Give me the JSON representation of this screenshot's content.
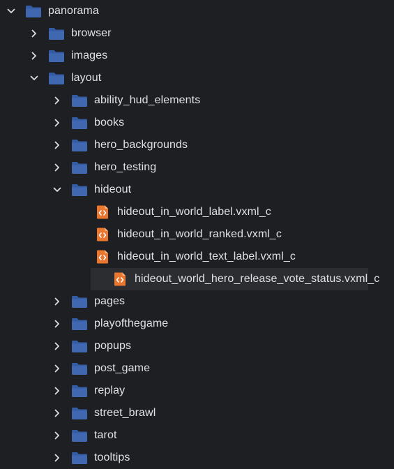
{
  "colors": {
    "background": "#1e1f22",
    "selected_row": "#2b2d30",
    "folder_body": "#3f68b0",
    "folder_tab": "#335ca5",
    "file_icon": "#e9772f",
    "text": "#dfe1e5"
  },
  "tree": [
    {
      "label": "panorama",
      "depth": 0,
      "type": "folder",
      "state": "expanded",
      "icon": "folder-icon"
    },
    {
      "label": "browser",
      "depth": 1,
      "type": "folder",
      "state": "collapsed",
      "icon": "folder-icon"
    },
    {
      "label": "images",
      "depth": 1,
      "type": "folder",
      "state": "collapsed",
      "icon": "folder-icon"
    },
    {
      "label": "layout",
      "depth": 1,
      "type": "folder",
      "state": "expanded",
      "icon": "folder-icon"
    },
    {
      "label": "ability_hud_elements",
      "depth": 2,
      "type": "folder",
      "state": "collapsed",
      "icon": "folder-icon"
    },
    {
      "label": "books",
      "depth": 2,
      "type": "folder",
      "state": "collapsed",
      "icon": "folder-icon"
    },
    {
      "label": "hero_backgrounds",
      "depth": 2,
      "type": "folder",
      "state": "collapsed",
      "icon": "folder-icon"
    },
    {
      "label": "hero_testing",
      "depth": 2,
      "type": "folder",
      "state": "collapsed",
      "icon": "folder-icon"
    },
    {
      "label": "hideout",
      "depth": 2,
      "type": "folder",
      "state": "expanded",
      "icon": "folder-icon"
    },
    {
      "label": "hideout_in_world_label.vxml_c",
      "depth": 3,
      "type": "file",
      "icon": "vxml-file-icon"
    },
    {
      "label": "hideout_in_world_ranked.vxml_c",
      "depth": 3,
      "type": "file",
      "icon": "vxml-file-icon"
    },
    {
      "label": "hideout_in_world_text_label.vxml_c",
      "depth": 3,
      "type": "file",
      "icon": "vxml-file-icon"
    },
    {
      "label": "hideout_world_hero_release_vote_status.vxml_c",
      "depth": 3,
      "type": "file",
      "icon": "vxml-file-icon",
      "selected": true
    },
    {
      "label": "pages",
      "depth": 2,
      "type": "folder",
      "state": "collapsed",
      "icon": "folder-icon"
    },
    {
      "label": "playofthegame",
      "depth": 2,
      "type": "folder",
      "state": "collapsed",
      "icon": "folder-icon"
    },
    {
      "label": "popups",
      "depth": 2,
      "type": "folder",
      "state": "collapsed",
      "icon": "folder-icon"
    },
    {
      "label": "post_game",
      "depth": 2,
      "type": "folder",
      "state": "collapsed",
      "icon": "folder-icon"
    },
    {
      "label": "replay",
      "depth": 2,
      "type": "folder",
      "state": "collapsed",
      "icon": "folder-icon"
    },
    {
      "label": "street_brawl",
      "depth": 2,
      "type": "folder",
      "state": "collapsed",
      "icon": "folder-icon"
    },
    {
      "label": "tarot",
      "depth": 2,
      "type": "folder",
      "state": "collapsed",
      "icon": "folder-icon"
    },
    {
      "label": "tooltips",
      "depth": 2,
      "type": "folder",
      "state": "collapsed",
      "icon": "folder-icon"
    }
  ]
}
